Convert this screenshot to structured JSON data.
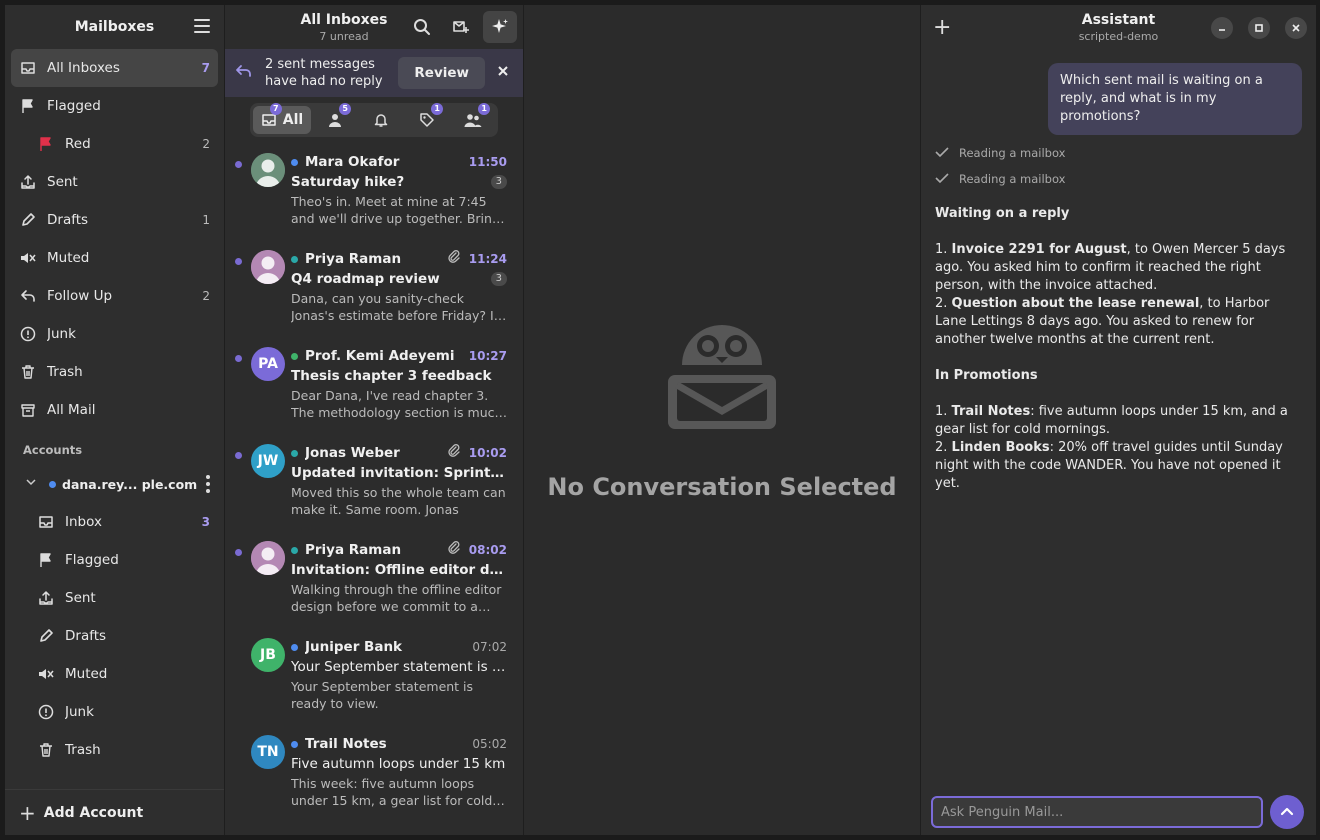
{
  "sidebar": {
    "title": "Mailboxes",
    "items": [
      {
        "label": "All Inboxes",
        "count": "7"
      },
      {
        "label": "Flagged",
        "count": ""
      },
      {
        "label": "Red",
        "count": "2"
      },
      {
        "label": "Sent",
        "count": ""
      },
      {
        "label": "Drafts",
        "count": "1"
      },
      {
        "label": "Muted",
        "count": ""
      },
      {
        "label": "Follow Up",
        "count": "2"
      },
      {
        "label": "Junk",
        "count": ""
      },
      {
        "label": "Trash",
        "count": ""
      },
      {
        "label": "All Mail",
        "count": ""
      }
    ],
    "accounts_label": "Accounts",
    "account": {
      "name": "dana.rey... ple.com",
      "items": [
        {
          "label": "Inbox",
          "count": "3"
        },
        {
          "label": "Flagged",
          "count": ""
        },
        {
          "label": "Sent",
          "count": ""
        },
        {
          "label": "Drafts",
          "count": ""
        },
        {
          "label": "Muted",
          "count": ""
        },
        {
          "label": "Junk",
          "count": ""
        },
        {
          "label": "Trash",
          "count": ""
        }
      ]
    },
    "add_account": "Add Account"
  },
  "list": {
    "title": "All Inboxes",
    "subtitle": "7 unread",
    "banner": {
      "line1": "2 sent messages",
      "line2": "have had no reply",
      "action": "Review"
    },
    "filters": {
      "all_label": "All",
      "all_badge": "7",
      "people_badge": "5",
      "tags_badge": "1",
      "groups_badge": "1"
    },
    "messages": [
      {
        "sender": "Mara Okafor",
        "time": "11:50",
        "subject": "Saturday hike?",
        "count": "3",
        "preview": "Theo's in. Meet at mine at 7:45 and we'll drive up together. Bring layers.",
        "initials": "",
        "dot": "#4f8cf0",
        "avcolor": "#6b8f7a"
      },
      {
        "sender": "Priya Raman",
        "time": "11:24",
        "subject": "Q4 roadmap review",
        "count": "3",
        "preview": "Dana, can you sanity-check Jonas's estimate before Friday? If last-write wins...",
        "initials": "",
        "dot": "#2aa8a8",
        "avcolor": "#b488b4"
      },
      {
        "sender": "Prof. Kemi Adeyemi",
        "time": "10:27",
        "subject": "Thesis chapter 3 feedback",
        "count": "",
        "preview": "Dear Dana, I've read chapter 3. The methodology section is much stronger.",
        "initials": "PA",
        "dot": "#3fb36a",
        "avcolor": "#7b6bd8"
      },
      {
        "sender": "Jonas Weber",
        "time": "10:02",
        "subject": "Updated invitation: Sprint planning",
        "count": "",
        "preview": "Moved this so the whole team can make it. Same room. Jonas",
        "initials": "JW",
        "dot": "#2aa8a8",
        "avcolor": "#2fa0c8"
      },
      {
        "sender": "Priya Raman",
        "time": "08:02",
        "subject": "Invitation: Offline editor design",
        "count": "",
        "preview": "Walking through the offline editor design before we commit to a data model.",
        "initials": "",
        "dot": "#2aa8a8",
        "avcolor": "#b488b4"
      },
      {
        "sender": "Juniper Bank",
        "time": "07:02",
        "subject": "Your September statement is ready",
        "count": "",
        "preview": "Your September statement is ready to view.",
        "initials": "JB",
        "dot": "#4f8cf0",
        "avcolor": "#3fb36a"
      },
      {
        "sender": "Trail Notes",
        "time": "05:02",
        "subject": "Five autumn loops under 15 km",
        "count": "",
        "preview": "This week: five autumn loops under 15 km, a gear list for cold mornings.",
        "initials": "TN",
        "dot": "#4f8cf0",
        "avcolor": "#2f88c0"
      }
    ]
  },
  "center": {
    "empty": "No Conversation Selected"
  },
  "assistant": {
    "title": "Assistant",
    "subtitle": "scripted-demo",
    "question": "Which sent mail is waiting on a reply, and what is in my promotions?",
    "steps": [
      "Reading a mailbox",
      "Reading a mailbox"
    ],
    "heading1": "Waiting on a reply",
    "w1_num": "1. ",
    "w1_bold": "Invoice 2291 for August",
    "w1_rest": ", to Owen Mercer 5 days ago. You asked him to confirm it reached the right person, with the invoice attached.",
    "w2_num": "2. ",
    "w2_bold": "Question about the lease renewal",
    "w2_rest": ", to Harbor Lane Lettings 8 days ago. You asked to renew for another twelve months at the current rent.",
    "heading2": "In Promotions",
    "p1_num": "1. ",
    "p1_bold": "Trail Notes",
    "p1_rest": ": five autumn loops under 15 km, and a gear list for cold mornings.",
    "p2_num": "2. ",
    "p2_bold": "Linden Books",
    "p2_rest": ": 20% off travel guides until Sunday night with the code WANDER. You have not opened it yet.",
    "placeholder": "Ask Penguin Mail..."
  }
}
